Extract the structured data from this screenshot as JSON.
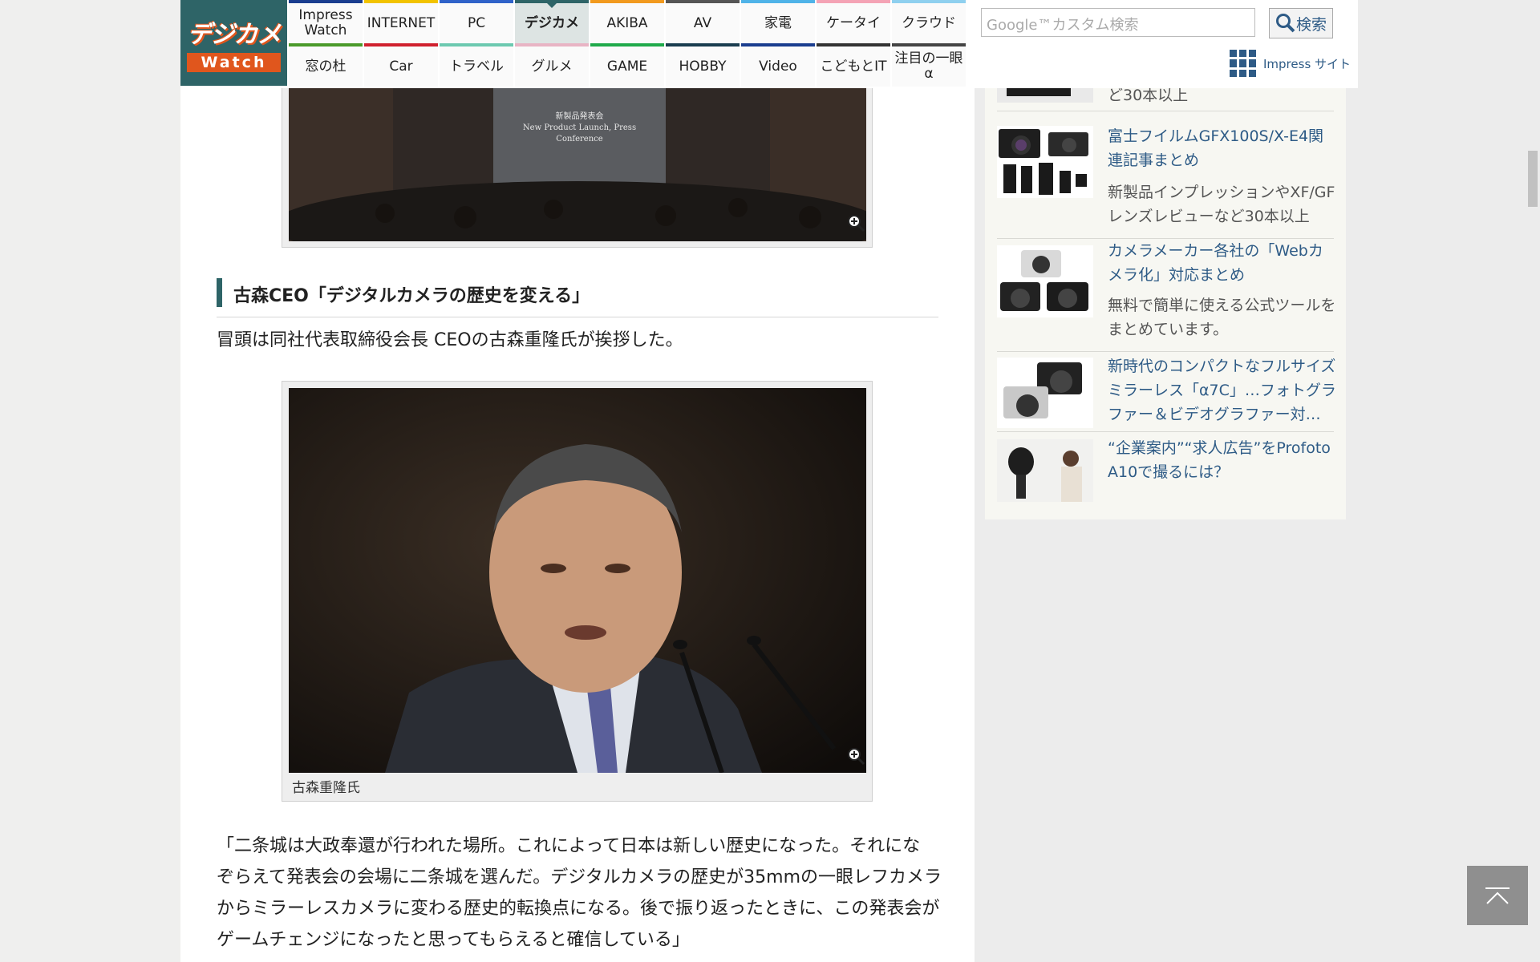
{
  "site": {
    "logo_main": "デジカメ",
    "logo_sub": "Watch"
  },
  "nav": {
    "row1": [
      {
        "label": "Impress Watch",
        "color": "#1a3d8f"
      },
      {
        "label": "INTERNET",
        "color": "#f2c300"
      },
      {
        "label": "PC",
        "color": "#2f62c9"
      },
      {
        "label": "デジカメ",
        "color": "#2e6467",
        "active": true
      },
      {
        "label": "AKIBA",
        "color": "#f29a1e"
      },
      {
        "label": "AV",
        "color": "#555555"
      },
      {
        "label": "家電",
        "color": "#4fb3e8"
      },
      {
        "label": "ケータイ",
        "color": "#f4a3b5"
      },
      {
        "label": "クラウド",
        "color": "#8fd0ef"
      }
    ],
    "row2": [
      {
        "label": "窓の杜",
        "color": "#4a9a2a"
      },
      {
        "label": "Car",
        "color": "#d0202e"
      },
      {
        "label": "トラベル",
        "color": "#6cc9b0"
      },
      {
        "label": "グルメ",
        "color": "#e8b4c4"
      },
      {
        "label": "GAME",
        "color": "#1faa4a"
      },
      {
        "label": "HOBBY",
        "color": "#1a3d4f"
      },
      {
        "label": "Video",
        "color": "#1a3d8f"
      },
      {
        "label": "こどもとIT",
        "color": "#333333"
      },
      {
        "label": "注目の一眼α",
        "color": "#444444"
      }
    ]
  },
  "search": {
    "placeholder": "Google™カスタム検索",
    "button_label": "検索"
  },
  "impress_link": "Impress サイト",
  "article": {
    "heading": "古森CEO「デジタルカメラの歴史を変える」",
    "intro": "冒頭は同社代表取締役会長 CEOの古森重隆氏が挨拶した。",
    "screen_line1": "新製品発表会",
    "screen_line2": "New Product Launch, Press Conference",
    "photo_caption": "古森重隆氏",
    "quote_lines": [
      "「二条城は大政奉還が行われた場所。これによって日本は新しい歴史になった。それにな",
      "ぞらえて発表会の会場に二条城を選んだ。デジタルカメラの歴史が35mmの一眼レフカメラ",
      "からミラーレスカメラに変わる歴史的転換点になる。後で振り返ったときに、この発表会が",
      "ゲームチェンジになったと思ってもらえると確信している」"
    ]
  },
  "sidebar": {
    "items": [
      {
        "title": "",
        "sub": "ど30本以上"
      },
      {
        "title": "富士フイルムGFX100S/X-E4関連記事まとめ",
        "sub": "新製品インプレッションやXF/GFレンズレビューなど30本以上"
      },
      {
        "title": "カメラメーカー各社の「Webカメラ化」対応まとめ",
        "sub": "無料で簡単に使える公式ツールをまとめています。"
      },
      {
        "title": "新時代のコンパクトなフルサイズミラーレス「α7C」…フォトグラファー＆ビデオグラファー対…",
        "sub": ""
      },
      {
        "title": "“企業案内”“求人広告”をProfoto A10で撮るには？",
        "sub": ""
      }
    ]
  }
}
